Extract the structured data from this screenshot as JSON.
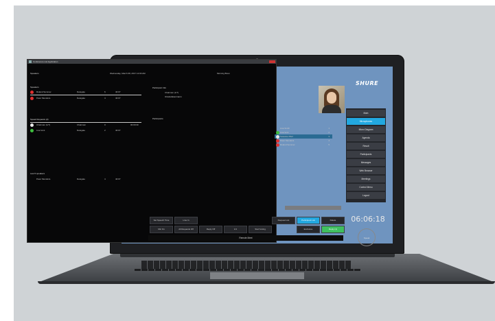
{
  "window": {
    "title": "Conference List Application",
    "date": "Wednesday, March 08, 2017 12:00 AM",
    "greeting": "Morning Brew"
  },
  "brand": {
    "logo": "SHURE"
  },
  "speakers": {
    "header": "Speakers",
    "rows": [
      {
        "name": "Roland Sommer",
        "group": "Delegate",
        "seat": "6",
        "time": "40:07",
        "dot": "#e03030"
      },
      {
        "name": "Peter Mendoza",
        "group": "Delegate",
        "seat": "4",
        "time": "40:07",
        "dot": "#e03030"
      }
    ]
  },
  "speak_requests": {
    "header": "Speak Requests (2)",
    "rows": [
      {
        "name": "Chairman (1/7)",
        "group": "Chairman",
        "seat": "0",
        "time": "00:00:30",
        "dot": "#e8e8e8"
      },
      {
        "name": "Lisa Vent",
        "group": "Delegate",
        "seat": "2",
        "time": "40:07",
        "dot": "#3fbf3f"
      }
    ]
  },
  "last_speakers": {
    "header": "Last 5 speakers",
    "rows": [
      {
        "name": "Peter Mendoza",
        "group": "Delegate",
        "seat": "4",
        "time": "40:07"
      }
    ]
  },
  "participant_info": {
    "header": "Participant Info",
    "role": "Chairman (1/7)",
    "name": "Ursula Eisenmann"
  },
  "participants": {
    "header": "Participants",
    "rows": [
      {
        "name": "Lisa Smith",
        "num": "1",
        "dot": "",
        "selected": false
      },
      {
        "name": "Lisa Vent",
        "num": "2",
        "dot": "#3fbf3f",
        "selected": false
      },
      {
        "name": "Susanne Pfeil",
        "num": "3",
        "dot": "#e8e8e8",
        "selected": true
      },
      {
        "name": "Peter Mendoza",
        "num": "4",
        "dot": "#e03030",
        "selected": false
      },
      {
        "name": "Roland Sommer",
        "num": "5",
        "dot": "#e03030",
        "selected": false
      }
    ]
  },
  "menu": {
    "items": [
      {
        "label": "Main",
        "active": false
      },
      {
        "label": "Microphones",
        "active": true
      },
      {
        "label": "Micro Diagram",
        "active": false
      },
      {
        "label": "Agenda",
        "active": false
      },
      {
        "label": "Result",
        "active": false
      },
      {
        "label": "Participants",
        "active": false
      },
      {
        "label": "Messages",
        "active": false
      },
      {
        "label": "Web Browser",
        "active": false
      },
      {
        "label": "Meetings",
        "active": false
      },
      {
        "label": "Control Menu",
        "active": false
      },
      {
        "label": "Logout",
        "active": false
      }
    ]
  },
  "buttons_row1": {
    "set_speech_time": "Set Speech Time",
    "line_in": "Line In",
    "request_list": "Request List",
    "participant_list": "Participant List",
    "delete": "Delete"
  },
  "buttons_row2": {
    "mic_on": "Mic On",
    "all_requests_off": "All Requests Off",
    "reply_off": "Reply Off",
    "one_of_one": "1/1",
    "start_voting": "Start Voting",
    "exclusive": "Exclusive",
    "reply": "Reply (1)"
  },
  "footer": {
    "label": "Remote Meet"
  },
  "timer": {
    "value": "06:06:18"
  },
  "speak_button": {
    "label": "Speak"
  },
  "colors": {
    "accent": "#22a8e0",
    "reply_green": "#3fbf60",
    "mic_red": "#e03030",
    "screen_blue": "#6f94bf"
  },
  "icons": [
    "app-icon",
    "close-icon",
    "participant-photo"
  ]
}
